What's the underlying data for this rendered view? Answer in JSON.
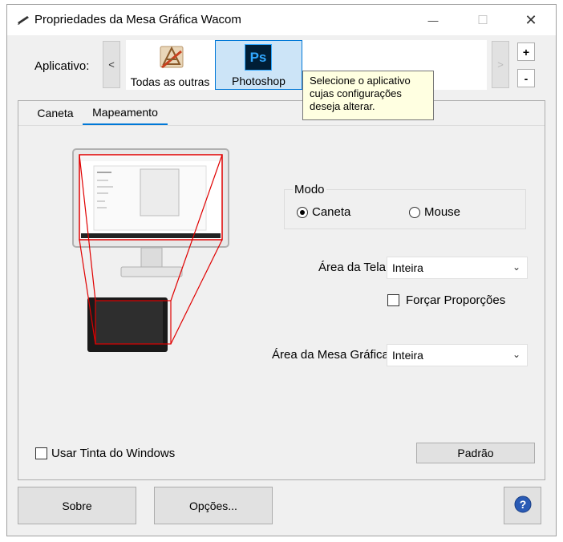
{
  "window": {
    "title": "Propriedades da Mesa Gráfica Wacom",
    "minimize": "—",
    "maximize": "☐",
    "close": "✕"
  },
  "app_bar": {
    "label": "Aplicativo:",
    "prev": "<",
    "next": ">",
    "add": "+",
    "remove": "-",
    "apps": [
      {
        "name": "Todas as outras",
        "icon": "all-apps-icon"
      },
      {
        "name": "Photoshop",
        "icon": "photoshop-icon",
        "selected": true
      }
    ],
    "photoshop_glyph": "Ps",
    "tooltip": [
      "Selecione o aplicativo",
      "cujas configurações",
      "deseja alterar."
    ]
  },
  "tabs": [
    {
      "label": "Caneta"
    },
    {
      "label": "Mapeamento",
      "selected": true
    }
  ],
  "mapping": {
    "mode_label": "Modo",
    "mode_options": [
      {
        "label": "Caneta",
        "selected": true
      },
      {
        "label": "Mouse",
        "selected": false
      }
    ],
    "screen_area_label": "Área da Tela:",
    "screen_area_value": "Inteira",
    "force_proportions_label": "Forçar Proporções",
    "force_proportions_checked": false,
    "tablet_area_label": "Área da Mesa Gráfica:",
    "tablet_area_value": "Inteira",
    "windows_ink_label": "Usar Tinta do Windows",
    "windows_ink_checked": false,
    "default_button": "Padrão"
  },
  "footer": {
    "about_button": "Sobre",
    "options_button": "Opções...",
    "help_icon": "help-icon"
  },
  "colors": {
    "accent": "#0078d7",
    "mapping_lines": "#e00000",
    "photoshop_bg": "#001e36",
    "photoshop_text": "#31a8ff",
    "help_blue": "#2a5bb5"
  }
}
